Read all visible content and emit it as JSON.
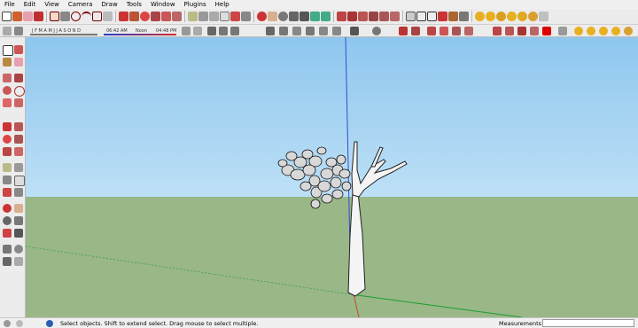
{
  "menu": [
    "File",
    "Edit",
    "View",
    "Camera",
    "Draw",
    "Tools",
    "Window",
    "Plugins",
    "Help"
  ],
  "shadow_settings": {
    "months": "J F M A M J J A S O N D",
    "time_start": "06:42 AM",
    "time_mid": "Noon",
    "time_end": "04:48 PM"
  },
  "status": {
    "hint": "Select objects. Shift to extend select. Drag mouse to select multiple.",
    "measurements_label": "Measurements",
    "measurements_value": ""
  },
  "colors": {
    "sky": "#8ec6ee",
    "ground": "#99b787",
    "blue_axis": "#2d4fd0",
    "red_axis": "#c84a2a",
    "green_axis": "#1d9d2d"
  },
  "toolbar_icons": [
    "select-icon",
    "make-component-icon",
    "eraser-icon",
    "paint-bucket-icon",
    "rectangle-icon",
    "line-icon",
    "circle-icon",
    "arc-icon",
    "polygon-icon",
    "freehand-icon",
    "move-icon",
    "push-pull-icon",
    "rotate-icon",
    "follow-me-icon",
    "scale-icon",
    "offset-icon",
    "tape-measure-icon",
    "dimension-icon",
    "protractor-icon",
    "text-icon",
    "axes-icon",
    "3d-text-icon",
    "orbit-icon",
    "pan-icon",
    "zoom-icon",
    "zoom-window-icon",
    "zoom-extents-icon",
    "previous-view-icon",
    "next-view-icon",
    "iso-view-icon",
    "top-view-icon",
    "front-view-icon",
    "right-view-icon",
    "back-view-icon",
    "left-view-icon",
    "xray-icon",
    "wireframe-icon",
    "hidden-line-icon",
    "shaded-icon",
    "shaded-texture-icon",
    "monochrome-icon"
  ]
}
